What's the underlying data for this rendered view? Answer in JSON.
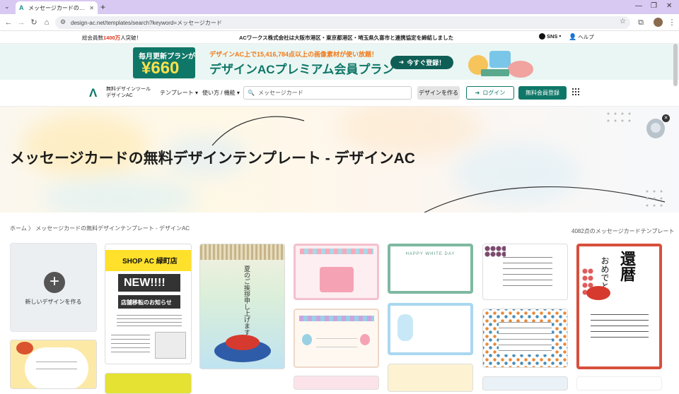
{
  "browser": {
    "tab_title": "メッセージカードの無料デザインテンプ",
    "url": "design-ac.net/templates/search?keyword=メッセージカード"
  },
  "topstrip": {
    "members_prefix": "総会員数",
    "members_count": "1400万",
    "members_suffix": "人突破！",
    "notice": "ACワークス株式会社は大阪市港区・東京都港区・埼玉県久喜市と連携協定を締結しました",
    "sns": "SNS",
    "help": "ヘルプ"
  },
  "banner": {
    "price_top": "毎月更新プランが",
    "price": "¥660",
    "headline": "デザインAC上で15,416,784点以上の画像素材が使い放題！",
    "plan": "デザインACプレミアム会員プラン",
    "cta": "今すぐ登録！"
  },
  "nav": {
    "logo_line1": "無料デザインツール",
    "logo_line2": "デザインAC",
    "templates": "テンプレート",
    "usage": "使い方 / 機能",
    "search_value": "メッセージカード",
    "make_design": "デザインを作る",
    "login": "ログイン",
    "register": "無料会員登録"
  },
  "hero": {
    "title": "メッセージカードの無料デザインテンプレート - デザインAC"
  },
  "breadcrumb": {
    "home": "ホーム",
    "sep": "〉",
    "current": "メッセージカードの無料デザインテンプレート - デザインAC"
  },
  "results": {
    "count_text": "4082点のメッセージカードテンプレート"
  },
  "new_design": {
    "label": "新しいデザインを作る"
  },
  "cards": {
    "shop_title": "SHOP AC 緑町店",
    "shop_new": "NEW!!!!",
    "shop_sub": "店舗移転のお知らせ",
    "summer": "夏のご挨拶申し上げます",
    "white_day": "HAPPY WHITE DAY",
    "kanreki_top": "還暦",
    "kanreki_side": "おめでとう"
  },
  "colors": {
    "accent": "#0f7768",
    "banner_bg": "#eaf6f3",
    "tabbar": "#d8c9f3"
  }
}
